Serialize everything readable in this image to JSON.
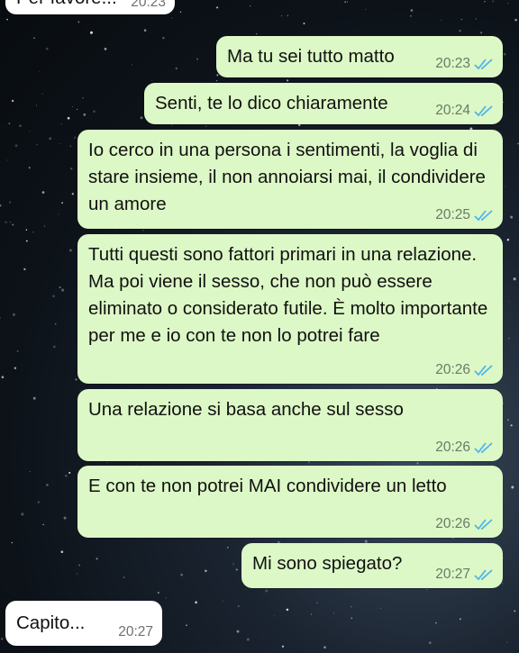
{
  "messages": [
    {
      "id": "m0",
      "dir": "in",
      "text": "Per favore...",
      "time": "20:23"
    },
    {
      "id": "m1",
      "dir": "out",
      "text": "Ma tu sei tutto matto",
      "time": "20:23",
      "read": true
    },
    {
      "id": "m2",
      "dir": "out",
      "text": "Senti, te lo dico chiaramente",
      "time": "20:24",
      "read": true
    },
    {
      "id": "m3",
      "dir": "out",
      "text": "Io cerco in una persona i sentimenti, la voglia di stare insieme, il non annoiarsi mai, il condividere un amore",
      "time": "20:25",
      "read": true
    },
    {
      "id": "m4",
      "dir": "out",
      "text": "Tutti questi sono fattori primari in una relazione. Ma poi viene il sesso, che non può essere eliminato o considerato futile. È molto importante per me e io con te non lo potrei fare",
      "time": "20:26",
      "read": true
    },
    {
      "id": "m5",
      "dir": "out",
      "text": "Una relazione si basa anche sul sesso",
      "time": "20:26",
      "read": true
    },
    {
      "id": "m6",
      "dir": "out",
      "text": "E con te non potrei MAI condividere un letto",
      "time": "20:26",
      "read": true
    },
    {
      "id": "m7",
      "dir": "out",
      "text": "Mi sono spiegato?",
      "time": "20:27",
      "read": true
    },
    {
      "id": "m8",
      "dir": "in",
      "text": "Capito...",
      "time": "20:27"
    }
  ],
  "colors": {
    "outgoing_bubble": "#dcf8c6",
    "incoming_bubble": "#ffffff",
    "read_ticks": "#4fb6ec"
  }
}
